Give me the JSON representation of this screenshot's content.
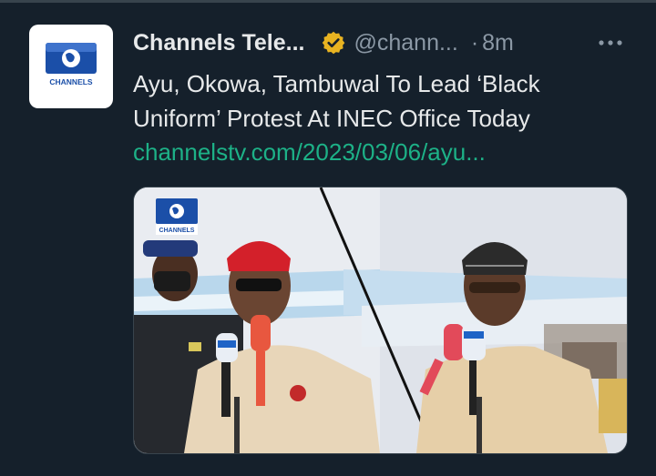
{
  "tweet": {
    "display_name": "Channels Tele...",
    "handle": "@chann...",
    "separator": "·",
    "time": "8m",
    "text": "Ayu, Okowa, Tambuwal To Lead ‘Black Uniform’ Protest At INEC Office Today",
    "link": "channelstv.com/2023/03/06/ayu..."
  },
  "avatar": {
    "logo_text": "CHANNELS"
  },
  "media": {
    "watermark_text": "CHANNELS"
  },
  "icons": {
    "verified": "verified-badge-icon",
    "more": "more-options-icon"
  },
  "colors": {
    "background": "#15202b",
    "link": "#1db187",
    "verified_badge": "#e8b321",
    "secondary_text": "#8b98a5",
    "channels_blue": "#1b4fa8"
  }
}
